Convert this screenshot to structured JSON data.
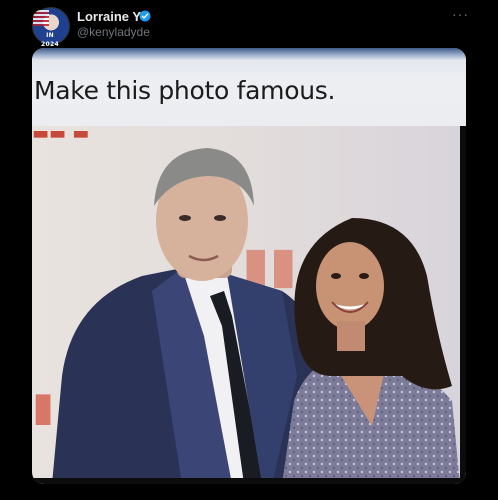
{
  "post": {
    "author": {
      "display_name": "Lorraine Y",
      "handle": "@kenyladyde",
      "verified": true,
      "avatar_badge": "IN 2024",
      "avatar_icon": "us-flag-portrait-avatar"
    },
    "more_icon": "ellipsis-icon",
    "image": {
      "caption": "Make this photo famous.",
      "description_icon": "photo-two-people-event"
    }
  },
  "colors": {
    "background": "#000000",
    "name": "#e7e9ea",
    "handle": "#71767b",
    "verified": "#1d9bf0"
  }
}
